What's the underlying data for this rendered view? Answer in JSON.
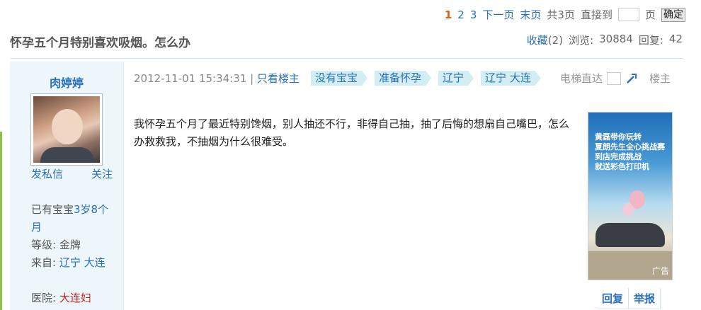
{
  "pager": {
    "current": "1",
    "pages": [
      "2",
      "3"
    ],
    "next": "下一页",
    "last": "末页",
    "total": "共3页",
    "jump_label": "直接到",
    "jump_value": "",
    "page_suffix": "页",
    "confirm": "确定"
  },
  "thread": {
    "title": "怀孕五个月特别喜欢吸烟。怎么办",
    "favorite": "收藏",
    "favorite_count": "(2)",
    "views_label": "浏览:",
    "views": "30884",
    "replies_label": "回复:",
    "replies": "42"
  },
  "author": {
    "name": "肉婷婷",
    "message": "发私信",
    "follow": "关注",
    "baby_label": "已有宝宝",
    "baby_age": "3岁8个月",
    "level_label": "等级:",
    "level": "金牌",
    "from_label": "来自:",
    "from": "辽宁 大连",
    "hospital_label": "医院:",
    "hospital": "大连妇"
  },
  "post": {
    "timestamp": "2012-11-01 15:34:31 |",
    "only_author": "只看楼主",
    "tags": [
      "没有宝宝",
      "准备怀孕",
      "辽宁",
      "辽宁 大连"
    ],
    "elevator_label": "电梯直达",
    "floor_label": "楼主",
    "content": "我怀孕五个月了最近特别馋烟，别人抽还不行，非得自己抽，抽了后悔的想扇自己嘴巴，怎么办救救我，不抽烟为什么很难受。"
  },
  "ad": {
    "line1": "黄磊带你玩转",
    "line2": "夏朗先生全心挑战赛",
    "line3": "到店完成挑战",
    "line4": "就送彩色打印机",
    "label": "广告"
  },
  "actions": {
    "reply": "回复",
    "report": "举报"
  },
  "colors": {
    "link": "#2a6fb8",
    "current_page": "#e05a1b",
    "side_bg": "#edf7fb",
    "tag_bg": "#d2eef2"
  },
  "icons": {
    "elevator_go": "arrow-jump-icon"
  }
}
